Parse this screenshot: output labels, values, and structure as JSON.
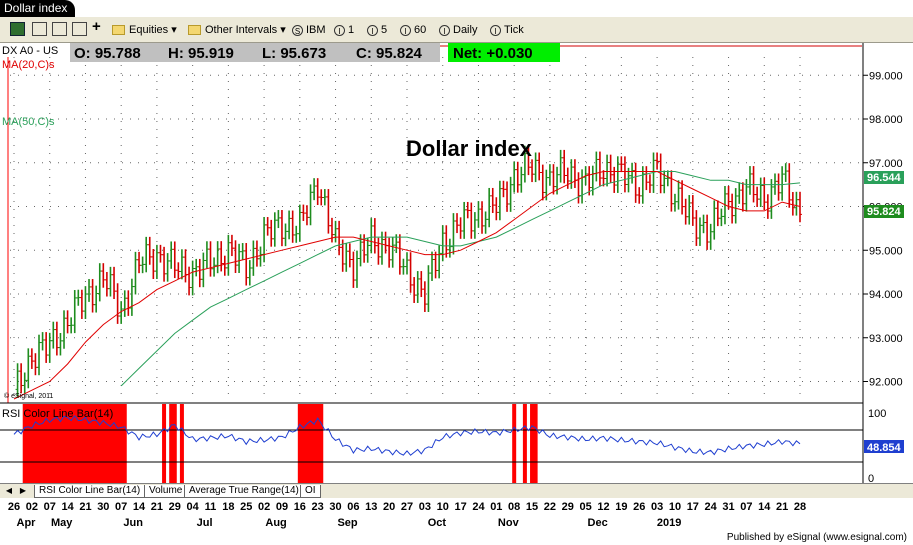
{
  "window": {
    "title": "Dollar index"
  },
  "toolbar": {
    "equities_label": "Equities",
    "other_intervals_label": "Other Intervals",
    "symbol_button": "IBM",
    "interval_buttons": [
      "1",
      "5",
      "60",
      "Daily",
      "Tick"
    ],
    "interval_icons": [
      "I",
      "I",
      "I",
      "I",
      "I"
    ],
    "symbol_icon": "S"
  },
  "quote": {
    "symbol": "DX A0 - US",
    "open": "O: 95.788",
    "high": "H: 95.919",
    "low": "L: 95.673",
    "close": "C: 95.824",
    "net": "Net: +0.030"
  },
  "studies": {
    "ma20": "MA(20,C)s",
    "ma50": "MA(50,C)s",
    "rsi": "RSI Color Line Bar(14)",
    "copyright": "© eSignal, 2011"
  },
  "chart_title": "Dollar index",
  "price_axis": {
    "ticks": [
      "99.000",
      "98.000",
      "97.000",
      "96.000",
      "95.000",
      "94.000",
      "93.000",
      "92.000"
    ],
    "last_ma_value": "96.544",
    "last_price": "95.824"
  },
  "rsi_axis": {
    "ticks": [
      "100",
      "0"
    ],
    "last_value": "48.854"
  },
  "bottom_tabs": [
    "RSI Color Line Bar(14)",
    "Volume",
    "Average True Range(14)",
    "OI"
  ],
  "x_axis": {
    "days": [
      "26",
      "02",
      "07",
      "14",
      "21",
      "30",
      "07",
      "14",
      "21",
      "29",
      "04",
      "11",
      "18",
      "25",
      "02",
      "09",
      "16",
      "23",
      "30",
      "06",
      "13",
      "20",
      "27",
      "03",
      "10",
      "17",
      "24",
      "01",
      "08",
      "15",
      "22",
      "29",
      "05",
      "12",
      "19",
      "26",
      "03",
      "10",
      "17",
      "24",
      "31",
      "07",
      "14",
      "21",
      "28"
    ],
    "months": [
      "Apr",
      "May",
      "Jun",
      "Jul",
      "Aug",
      "Sep",
      "Oct",
      "Nov",
      "Dec",
      "2019"
    ]
  },
  "footer": {
    "text": "Published by eSignal (www.esignal.com)"
  },
  "colors": {
    "up_bar": "#1e8c1e",
    "down_bar": "#d40000",
    "ma20": "#e00000",
    "ma50": "#2aa05a",
    "rsi_line": "#1f3fd0",
    "overbought": "#ff0000",
    "oversold": "#00cc00",
    "net_bg": "#00ee00"
  },
  "chart_data": {
    "type": "line",
    "title": "Dollar index",
    "x": [
      "2018-04-26",
      "2018-05-02",
      "2018-05-07",
      "2018-05-14",
      "2018-05-21",
      "2018-05-30",
      "2018-06-07",
      "2018-06-14",
      "2018-06-21",
      "2018-06-29",
      "2018-07-04",
      "2018-07-11",
      "2018-07-18",
      "2018-07-25",
      "2018-08-02",
      "2018-08-09",
      "2018-08-16",
      "2018-08-23",
      "2018-08-30",
      "2018-09-06",
      "2018-09-13",
      "2018-09-20",
      "2018-09-27",
      "2018-10-03",
      "2018-10-10",
      "2018-10-17",
      "2018-10-24",
      "2018-11-01",
      "2018-11-08",
      "2018-11-15",
      "2018-11-22",
      "2018-11-29",
      "2018-12-05",
      "2018-12-12",
      "2018-12-19",
      "2018-12-26",
      "2019-01-03",
      "2019-01-10",
      "2019-01-17",
      "2019-01-24",
      "2019-01-31",
      "2019-02-07",
      "2019-02-14",
      "2019-02-21",
      "2019-02-28"
    ],
    "series": [
      {
        "name": "DX A0 - US",
        "values": [
          91.7,
          92.6,
          92.8,
          93.4,
          93.9,
          94.4,
          93.6,
          94.7,
          94.9,
          94.6,
          94.5,
          94.7,
          95.0,
          94.6,
          95.3,
          95.6,
          95.5,
          96.6,
          95.1,
          94.7,
          95.2,
          95.1,
          94.5,
          94.0,
          95.2,
          95.6,
          95.8,
          96.0,
          96.7,
          96.9,
          96.6,
          96.8,
          96.5,
          96.9,
          96.7,
          96.5,
          96.8,
          96.3,
          95.6,
          95.5,
          96.1,
          96.4,
          96.2,
          96.6,
          95.82
        ]
      },
      {
        "name": "MA(20,C)s",
        "values": [
          91.6,
          91.8,
          92.0,
          92.4,
          92.9,
          93.3,
          93.6,
          93.8,
          94.1,
          94.3,
          94.5,
          94.6,
          94.7,
          94.8,
          94.9,
          95.0,
          95.1,
          95.2,
          95.3,
          95.3,
          95.2,
          95.1,
          95.0,
          94.9,
          94.9,
          95.0,
          95.2,
          95.4,
          95.7,
          96.0,
          96.3,
          96.5,
          96.7,
          96.8,
          96.8,
          96.8,
          96.8,
          96.6,
          96.4,
          96.2,
          96.0,
          95.9,
          95.9,
          96.1,
          96.0
        ]
      },
      {
        "name": "MA(50,C)s",
        "values": [
          null,
          null,
          null,
          null,
          null,
          null,
          91.9,
          92.3,
          92.7,
          93.1,
          93.4,
          93.7,
          93.9,
          94.1,
          94.3,
          94.5,
          94.7,
          94.9,
          95.1,
          95.2,
          95.3,
          95.3,
          95.3,
          95.2,
          95.1,
          95.1,
          95.2,
          95.3,
          95.5,
          95.7,
          95.9,
          96.1,
          96.3,
          96.5,
          96.6,
          96.7,
          96.8,
          96.8,
          96.7,
          96.6,
          96.6,
          96.5,
          96.5,
          96.5,
          96.54
        ]
      }
    ],
    "ylim": [
      91.6,
      99.6
    ],
    "yticks": [
      92,
      93,
      94,
      95,
      96,
      97,
      98,
      99
    ],
    "grid": true,
    "rsi": {
      "name": "RSI Color Line Bar(14)",
      "values": [
        62,
        74,
        82,
        85,
        82,
        78,
        72,
        58,
        62,
        75,
        55,
        57,
        60,
        52,
        54,
        58,
        72,
        82,
        55,
        40,
        42,
        38,
        35,
        40,
        58,
        64,
        66,
        64,
        68,
        72,
        60,
        58,
        55,
        57,
        54,
        52,
        50,
        44,
        38,
        37,
        42,
        46,
        48,
        52,
        48.854
      ],
      "ylim": [
        0,
        100
      ],
      "levels": [
        70,
        30
      ]
    }
  }
}
